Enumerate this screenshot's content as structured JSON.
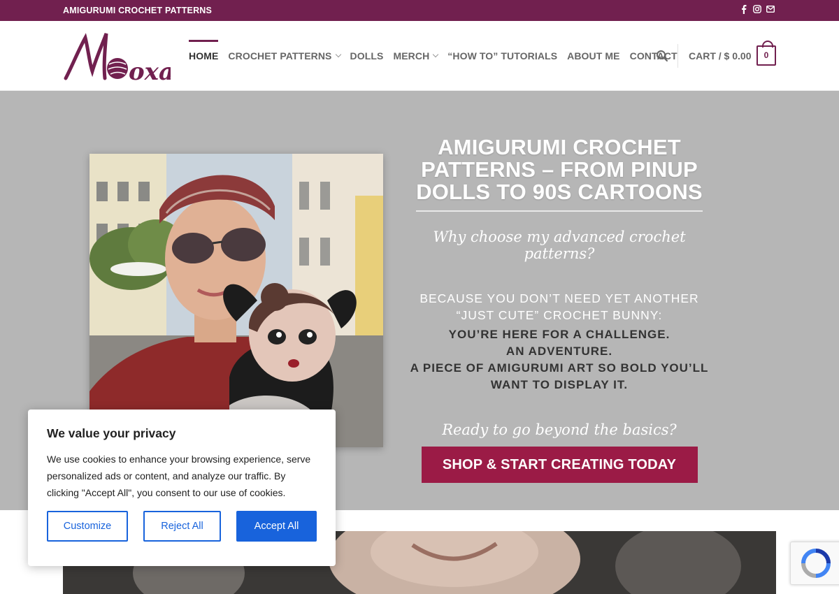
{
  "topbar": {
    "brand": "AMIGURUMI CROCHET PATTERNS",
    "social_icons": [
      "facebook-icon",
      "instagram-icon",
      "email-icon"
    ]
  },
  "header": {
    "logo_text": "Monoxa",
    "nav": [
      {
        "label": "HOME",
        "active": true
      },
      {
        "label": "CROCHET PATTERNS",
        "dropdown": true
      },
      {
        "label": "DOLLS"
      },
      {
        "label": "MERCH",
        "dropdown": true
      },
      {
        "label": "“HOW TO” TUTORIALS"
      },
      {
        "label": "ABOUT ME"
      },
      {
        "label": "CONTACT"
      }
    ],
    "cart_label": "CART / $ 0.00",
    "cart_count": "0"
  },
  "hero": {
    "title": "AMIGURUMI CROCHET PATTERNS – FROM PINUP DOLLS TO 90S CARTOONS",
    "subtitle_script": "Why choose my advanced crochet patterns?",
    "light_text": [
      "BECAUSE YOU DON’T NEED YET ANOTHER",
      "“JUST CUTE” CROCHET BUNNY:"
    ],
    "dark_text": [
      "YOU’RE HERE FOR A CHALLENGE.",
      "AN ADVENTURE.",
      "A PIECE OF AMIGURUMI ART SO BOLD YOU’LL",
      "WANT TO DISPLAY IT."
    ],
    "script2": "Ready to go beyond the basics?",
    "cta": "SHOP & START CREATING TODAY"
  },
  "cookie": {
    "title": "We value your privacy",
    "body": "We use cookies to enhance your browsing experience, serve personalized ads or content, and analyze our traffic. By clicking \"Accept All\", you consent to our use of cookies.",
    "customize": "Customize",
    "reject": "Reject All",
    "accept": "Accept All"
  },
  "colors": {
    "brand": "#71204f",
    "cta": "#9b1b46",
    "hero_bg": "#b6b6b6",
    "cookie_accent": "#1863dc"
  }
}
